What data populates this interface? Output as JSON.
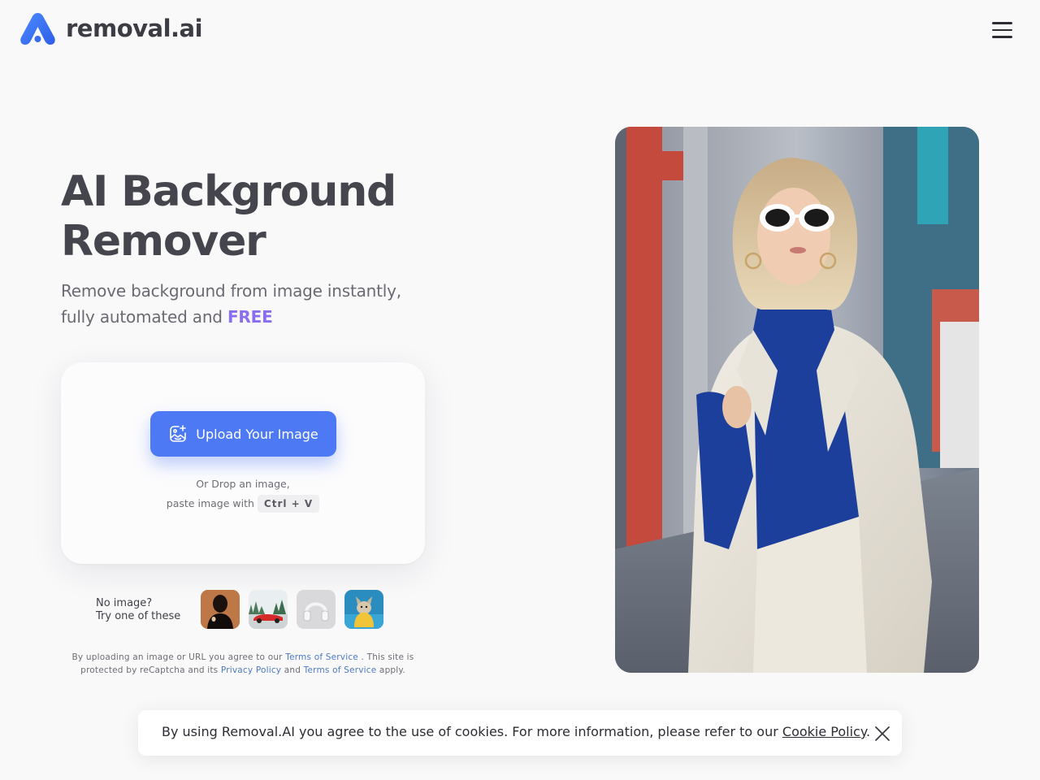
{
  "header": {
    "brand": "removal.ai",
    "logo_icon": "removal-ai-logo",
    "menu_icon": "hamburger-menu-icon"
  },
  "hero": {
    "title_line1": "AI Background",
    "title_line2": "Remover",
    "subtitle_line1": "Remove background from image instantly,",
    "subtitle_line2_prefix": "fully automated and ",
    "subtitle_free": "FREE"
  },
  "upload": {
    "button_label": "Upload Your Image",
    "button_icon": "image-upload-icon",
    "drop_line1": "Or Drop an image,",
    "drop_line2": "paste image with",
    "shortcut": "Ctrl + V"
  },
  "samples": {
    "prompt_line1": "No image?",
    "prompt_line2": "Try one of these",
    "items": [
      {
        "name": "portrait-sample"
      },
      {
        "name": "car-sample"
      },
      {
        "name": "headphones-sample"
      },
      {
        "name": "dog-sample"
      }
    ]
  },
  "legal": {
    "part1": "By uploading an image or URL you agree to our ",
    "terms1": "Terms of Service",
    "part2": " . This site is protected by reCaptcha and its ",
    "privacy": "Privacy Policy",
    "part3": " and ",
    "terms2": "Terms of Service",
    "part4": " apply."
  },
  "cookie": {
    "text": "By using Removal.AI you agree to the use of cookies. For more information, please refer to our ",
    "link": "Cookie Policy",
    "suffix": ".",
    "close_icon": "close-icon"
  },
  "colors": {
    "accent": "#4d79f5",
    "free": "#8a6ef0",
    "link": "#4d79c5"
  }
}
